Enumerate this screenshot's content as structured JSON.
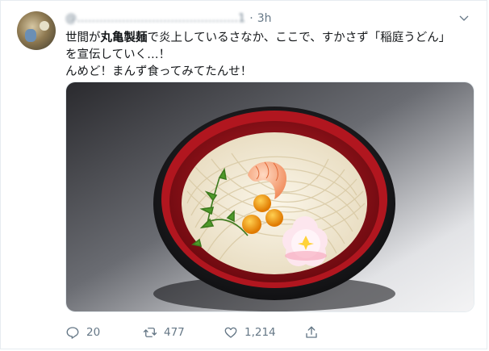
{
  "tweet": {
    "handle": "@...........................................1",
    "separator": "·",
    "time": "3h",
    "text": {
      "line1_prefix": "世間が",
      "line1_bold": "丸亀製麺",
      "line1_suffix": "で炎上しているさなか、ここで、すかさず「稲庭うどん」",
      "line2": "を宣伝していく…！",
      "line3": "んめど！まんず食ってみてたんせ！"
    },
    "media": {
      "description_icon": "udon-bowl-photo"
    },
    "actions": {
      "reply_count": "20",
      "retweet_count": "477",
      "like_count": "1,214"
    }
  },
  "colors": {
    "secondary_text": "#657786",
    "border": "#e6ecf0",
    "bowl_red": "#a3141c"
  }
}
